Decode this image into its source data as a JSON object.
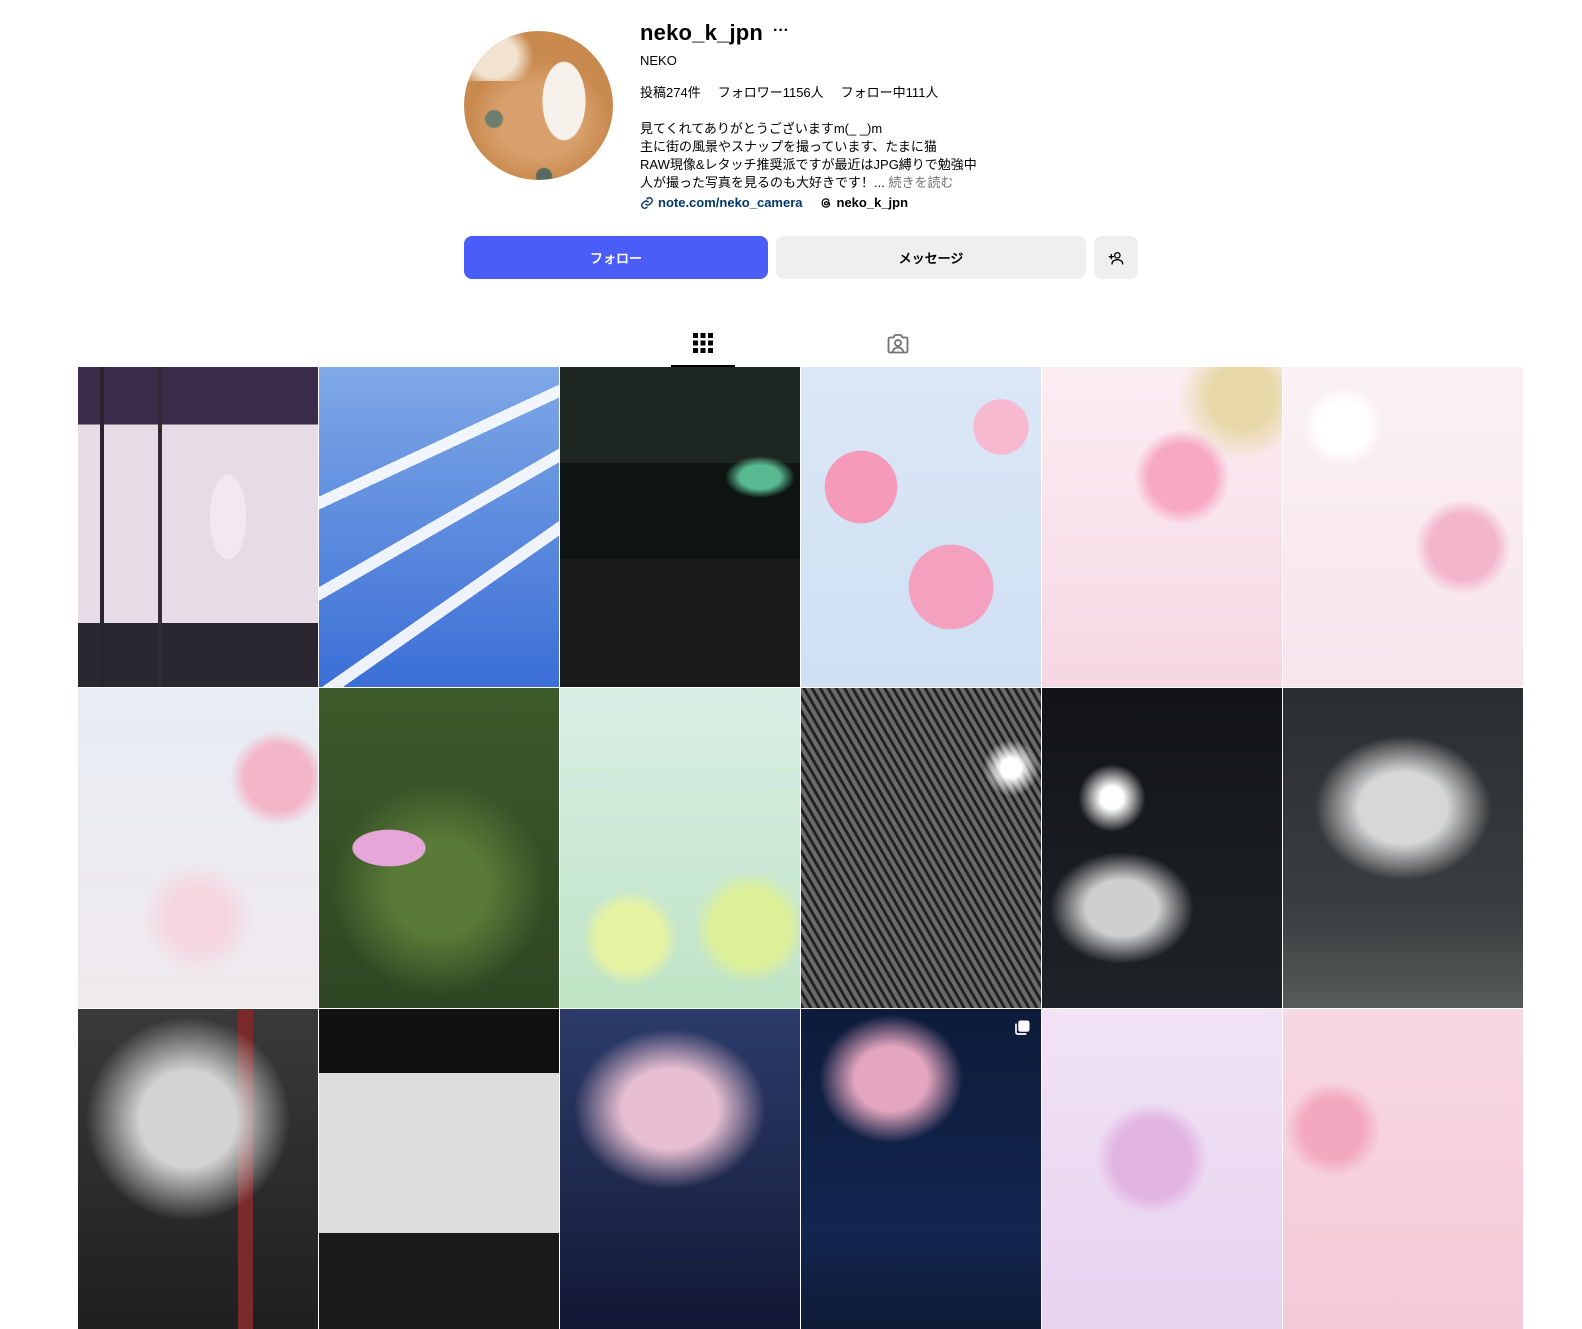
{
  "profile": {
    "username": "neko_k_jpn",
    "more": "···",
    "full_name": "NEKO",
    "stats": {
      "posts": "投稿274件",
      "followers": "フォロワー1156人",
      "following": "フォロー中111人"
    },
    "bio": [
      "見てくれてありがとうございますm(_ _)m",
      "主に街の風景やスナップを撮っています、たまに猫",
      "RAW現像&レタッチ推奨派ですが最近はJPG縛りで勉強中",
      "人が撮った写真を見るのも大好きです！..."
    ],
    "read_more": "続きを読む",
    "link": "note.com/neko_camera",
    "threads": "neko_k_jpn"
  },
  "actions": {
    "follow": "フォロー",
    "message": "メッセージ"
  },
  "icons": {
    "link": "link-icon",
    "threads": "threads-icon",
    "add_user": "add-user-icon",
    "grid": "grid-icon",
    "tagged": "tagged-icon",
    "multi": "multiple-photos-icon"
  },
  "colors": {
    "follow_button": "#4a5df9",
    "secondary_button": "#efefef",
    "link": "#00376b"
  },
  "posts": [
    {
      "subject": "shop window"
    },
    {
      "subject": "jets"
    },
    {
      "subject": "bar storefront"
    },
    {
      "subject": "bird in blossoms"
    },
    {
      "subject": "cherry blossoms"
    },
    {
      "subject": "cherry blossoms"
    },
    {
      "subject": "cherry blossoms"
    },
    {
      "subject": "cosmos"
    },
    {
      "subject": "yellow flowers"
    },
    {
      "subject": "night blossoms"
    },
    {
      "subject": "street lamp"
    },
    {
      "subject": "night park"
    },
    {
      "subject": "blossoms and stairs"
    },
    {
      "subject": "blossom trees"
    },
    {
      "subject": "riverside blossoms"
    },
    {
      "subject": "night skyline",
      "multi": true
    },
    {
      "subject": "purple blossoms"
    },
    {
      "subject": "pink blossoms"
    }
  ]
}
